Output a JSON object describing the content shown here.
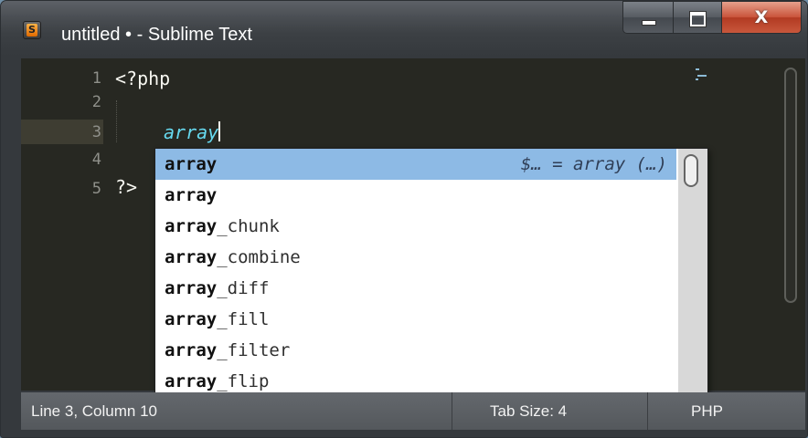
{
  "window": {
    "title": "untitled • - Sublime Text",
    "app_icon_letter": "S",
    "controls": {
      "minimize": "minimize",
      "maximize": "maximize",
      "close": "X"
    }
  },
  "editor": {
    "line_numbers": [
      "1",
      "2",
      "3",
      "4",
      "5"
    ],
    "active_line": 3,
    "lines": {
      "line1": "<?php",
      "line3_typed": "array",
      "line5": "?>"
    }
  },
  "autocomplete": {
    "items": [
      {
        "prefix": "array",
        "rest": "",
        "hint": "$… = array (…)"
      },
      {
        "prefix": "array",
        "rest": ""
      },
      {
        "prefix": "array",
        "rest": "_chunk"
      },
      {
        "prefix": "array",
        "rest": "_combine"
      },
      {
        "prefix": "array",
        "rest": "_diff"
      },
      {
        "prefix": "array",
        "rest": "_fill"
      },
      {
        "prefix": "array",
        "rest": "_filter"
      },
      {
        "prefix": "array",
        "rest": "_flip"
      }
    ],
    "selected_index": 0
  },
  "status": {
    "position": "Line 3, Column 10",
    "tab_size": "Tab Size: 4",
    "syntax": "PHP"
  },
  "colors": {
    "editor_bg": "#272822",
    "selection": "#8dbae5",
    "keyword": "#66d9ef"
  }
}
